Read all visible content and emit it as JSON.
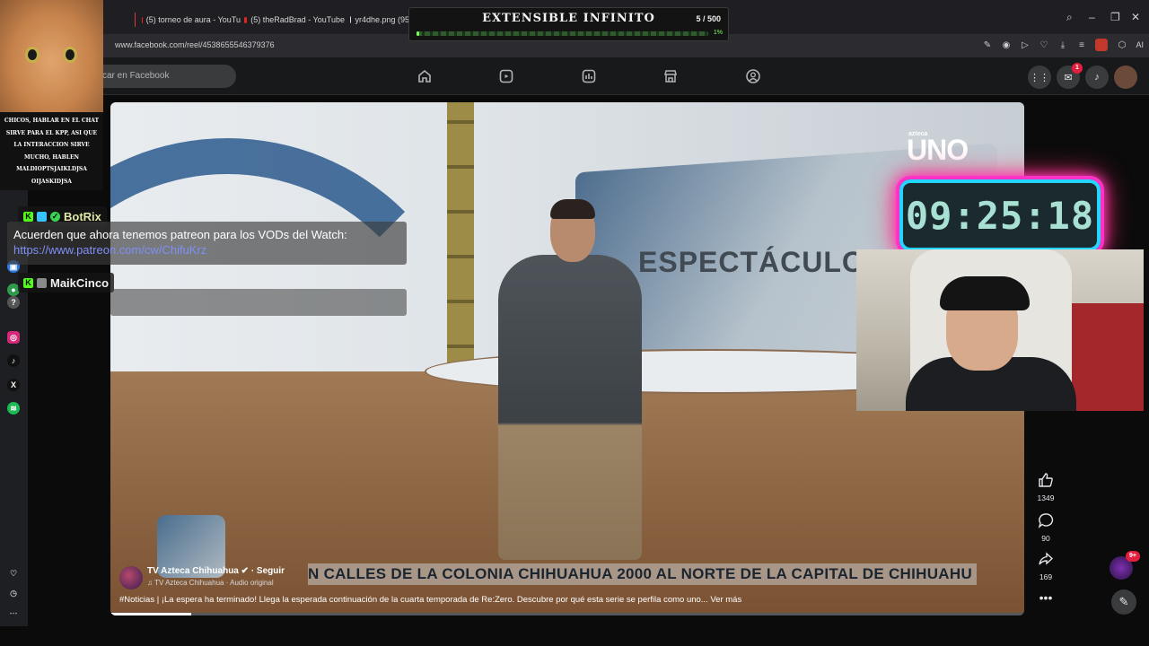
{
  "browser": {
    "tabs": [
      {
        "title": "(5) torneo de aura - YouTu"
      },
      {
        "title": "(5) theRadBrad - YouTube"
      },
      {
        "title": "yr4dhe.png (95"
      }
    ],
    "url": "www.facebook.com/reel/4538655546379376",
    "ai_label": "AI"
  },
  "goal_overlay": {
    "title": "EXTENSIBLE INFINITO",
    "count": "5 / 500",
    "percent_label": "1%",
    "progress_fraction": 0.01
  },
  "facebook": {
    "search_placeholder": "Buscar en Facebook",
    "search_visible_text": "scar en Facebook",
    "messenger_badge": "1",
    "notification_badge": "9+"
  },
  "stream_overlay": {
    "cat_message": "CHICOS, HABLAR EN EL CHAT SIRVE PARA EL KPP, ASI QUE LA INTERACCION SIRVE MUCHO, HABLEN MALDIOPTSJAIKLDJSA OIJASKIDJSA",
    "chat": [
      {
        "user": "BotRix",
        "message": "Acuerden que ahora tenemos patreon para los VODs del Watch:",
        "link": "https://www.patreon.com/cw/ChifuKrz"
      },
      {
        "user": "MaikCinco"
      }
    ],
    "timer": "09:25:18"
  },
  "video": {
    "channel_logo_small": "azteca",
    "channel_logo": "UNO",
    "screen_text": "ESPECTÁCULO",
    "ticker": "N CALLES DE LA COLONIA CHIHUAHUA 2000 AL NORTE DE LA CAPITAL DE CHIHUAHU",
    "page_name": "TV Azteca Chihuahua",
    "follow_label": "Seguir",
    "audio_line": "TV Azteca Chihuahua · Audio original",
    "caption": "#Noticias | ¡La espera ha terminado! Llega la esperada continuación de la cuarta temporada de Re:Zero. Descubre por qué esta serie se perfila como uno... Ver más",
    "playback_fraction": 0.088
  },
  "reel_actions": {
    "likes": "1349",
    "comments": "90",
    "shares": "169"
  },
  "colors": {
    "goal_green": "#7cff5e",
    "timer_pink": "#ff32c8",
    "timer_cyan": "#22d6ff",
    "fb_badge_red": "#e41e3f",
    "kick_green": "#53fc18"
  }
}
